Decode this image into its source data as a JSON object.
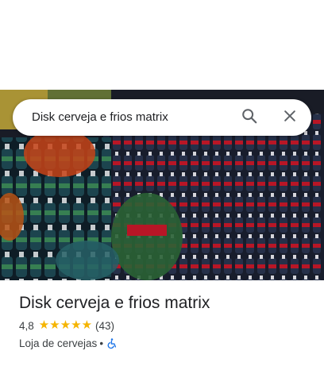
{
  "search": {
    "query": "Disk cerveja e frios matrix",
    "search_icon": "search-icon",
    "close_icon": "close-icon"
  },
  "place": {
    "photo_icon": "place-photo",
    "name": "Disk cerveja e frios matrix",
    "rating": "4,8",
    "stars": 5,
    "review_count": "(43)",
    "category": "Loja de cervejas",
    "separator": "•",
    "accessibility_icon": "wheelchair-icon"
  },
  "colors": {
    "star": "#f5b400",
    "accessibility": "#1a73e8",
    "text": "#202124",
    "secondary_text": "#3c4043"
  }
}
